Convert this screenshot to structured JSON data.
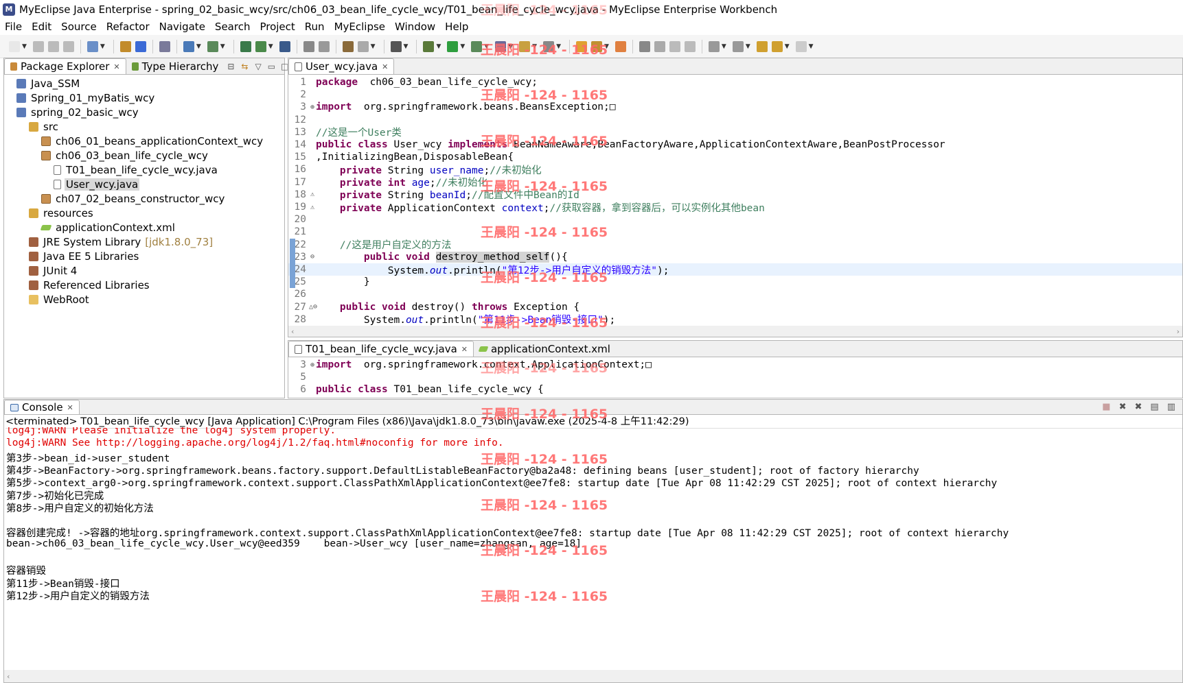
{
  "window": {
    "title": "MyEclipse Java Enterprise - spring_02_basic_wcy/src/ch06_03_bean_life_cycle_wcy/T01_bean_life_cycle_wcy.java - MyEclipse Enterprise Workbench"
  },
  "menu": [
    "File",
    "Edit",
    "Source",
    "Refactor",
    "Navigate",
    "Search",
    "Project",
    "Run",
    "MyEclipse",
    "Window",
    "Help"
  ],
  "explorer": {
    "tab_package": "Package Explorer",
    "tab_hierarchy": "Type Hierarchy",
    "items": [
      {
        "label": "Java_SSM",
        "icon": "project-icon"
      },
      {
        "label": "Spring_01_myBatis_wcy",
        "icon": "project-icon"
      },
      {
        "label": "spring_02_basic_wcy",
        "icon": "project-icon"
      },
      {
        "label": "src",
        "icon": "source-folder-icon"
      },
      {
        "label": "ch06_01_beans_applicationContext_wcy",
        "icon": "package-icon"
      },
      {
        "label": "ch06_03_bean_life_cycle_wcy",
        "icon": "package-icon"
      },
      {
        "label": "T01_bean_life_cycle_wcy.java",
        "icon": "java-file-icon"
      },
      {
        "label": "User_wcy.java",
        "icon": "java-file-icon"
      },
      {
        "label": "ch07_02_beans_constructor_wcy",
        "icon": "package-icon"
      },
      {
        "label": "resources",
        "icon": "source-folder-icon"
      },
      {
        "label": "applicationContext.xml",
        "icon": "xml-file-icon"
      },
      {
        "label": "JRE System Library",
        "extra": "[jdk1.8.0_73]",
        "icon": "library-icon"
      },
      {
        "label": "Java EE 5 Libraries",
        "icon": "library-icon"
      },
      {
        "label": "JUnit 4",
        "icon": "library-icon"
      },
      {
        "label": "Referenced Libraries",
        "icon": "library-icon"
      },
      {
        "label": "WebRoot",
        "icon": "folder-icon"
      }
    ]
  },
  "editor1": {
    "tab": "User_wcy.java",
    "lines": [
      {
        "n": "1",
        "t": [
          [
            "kw",
            "package"
          ],
          [
            "",
            "  ch06_03_bean_life_cycle_wcy;"
          ]
        ]
      },
      {
        "n": "2",
        "t": []
      },
      {
        "n": "3",
        "g": "⊕",
        "t": [
          [
            "kw",
            "import"
          ],
          [
            "",
            "  org.springframework.beans.BeansException;□"
          ]
        ]
      },
      {
        "n": "12",
        "t": []
      },
      {
        "n": "13",
        "t": [
          [
            "cm",
            "//这是一个User类"
          ]
        ]
      },
      {
        "n": "14",
        "t": [
          [
            "kw",
            "public class"
          ],
          [
            "",
            " User_wcy "
          ],
          [
            "kw",
            "implements"
          ],
          [
            "",
            " BeanNameAware,BeanFactoryAware,ApplicationContextAware,BeanPostProcessor"
          ]
        ]
      },
      {
        "n": "15",
        "t": [
          [
            "",
            ",InitializingBean,DisposableBean{"
          ]
        ]
      },
      {
        "n": "16",
        "t": [
          [
            "",
            "    "
          ],
          [
            "kw",
            "private"
          ],
          [
            "",
            " String "
          ],
          [
            "fld",
            "user_name"
          ],
          [
            "",
            ";"
          ],
          [
            "cm",
            "//未初始化"
          ]
        ]
      },
      {
        "n": "17",
        "t": [
          [
            "",
            "    "
          ],
          [
            "kw",
            "private int"
          ],
          [
            "",
            " "
          ],
          [
            "fld",
            "age"
          ],
          [
            "",
            ";"
          ],
          [
            "cm",
            "//未初始化"
          ]
        ]
      },
      {
        "n": "18",
        "g": "⚠",
        "t": [
          [
            "",
            "    "
          ],
          [
            "kw",
            "private"
          ],
          [
            "",
            " String "
          ],
          [
            "fld",
            "beanId"
          ],
          [
            "",
            ";"
          ],
          [
            "cm",
            "//配置文件中Bean的Id"
          ]
        ]
      },
      {
        "n": "19",
        "g": "⚠",
        "t": [
          [
            "",
            "    "
          ],
          [
            "kw",
            "private"
          ],
          [
            "",
            " ApplicationContext "
          ],
          [
            "fld",
            "context"
          ],
          [
            "",
            ";"
          ],
          [
            "cm",
            "//获取容器，拿到容器后，可以实例化其他bean"
          ]
        ]
      },
      {
        "n": "20",
        "t": []
      },
      {
        "n": "21",
        "t": []
      },
      {
        "n": "22",
        "t": [
          [
            "",
            "    "
          ],
          [
            "cm",
            "//这是用户自定义的方法"
          ]
        ]
      },
      {
        "n": "23",
        "g": "⊖",
        "t": [
          [
            "",
            "        "
          ],
          [
            "kw",
            "public void"
          ],
          [
            "",
            " "
          ],
          [
            "occ",
            "destroy_method_self"
          ],
          [
            "",
            "(){"
          ]
        ]
      },
      {
        "n": "24",
        "hl": true,
        "t": [
          [
            "",
            "            System."
          ],
          [
            "ital",
            "out"
          ],
          [
            "",
            ".println("
          ],
          [
            "str",
            "\"第12步->用户自定义的销毁方法\""
          ],
          [
            "",
            ");"
          ]
        ]
      },
      {
        "n": "25",
        "t": [
          [
            "",
            "        }"
          ]
        ]
      },
      {
        "n": "26",
        "t": []
      },
      {
        "n": "27",
        "g": "△⊖",
        "t": [
          [
            "",
            "    "
          ],
          [
            "kw",
            "public void"
          ],
          [
            "",
            " destroy() "
          ],
          [
            "kw",
            "throws"
          ],
          [
            "",
            " Exception {"
          ]
        ]
      },
      {
        "n": "28",
        "t": [
          [
            "",
            "        System."
          ],
          [
            "ital",
            "out"
          ],
          [
            "",
            ".println("
          ],
          [
            "str",
            "\"第11步->Bean销毁-接口\""
          ],
          [
            "",
            ");"
          ]
        ]
      }
    ]
  },
  "editor2": {
    "tab1": "T01_bean_life_cycle_wcy.java",
    "tab2": "applicationContext.xml",
    "lines": [
      {
        "n": "3",
        "g": "⊕",
        "t": [
          [
            "kw",
            "import"
          ],
          [
            "",
            "  org.springframework.context.ApplicationContext;□"
          ]
        ]
      },
      {
        "n": "5",
        "t": []
      },
      {
        "n": "6",
        "t": [
          [
            "kw",
            "public class"
          ],
          [
            "",
            " T01_bean_life_cycle_wcy {"
          ]
        ]
      }
    ]
  },
  "console": {
    "tab": "Console",
    "header": "<terminated> T01_bean_life_cycle_wcy [Java Application] C:\\Program Files (x86)\\Java\\jdk1.8.0_73\\bin\\javaw.exe (2025-4-8 上午11:42:29)",
    "lines": [
      {
        "c": "red",
        "t": "log4j:WARN Please initialize the log4j system properly."
      },
      {
        "c": "red",
        "t": "log4j:WARN See http://logging.apache.org/log4j/1.2/faq.html#noconfig for more info."
      },
      {
        "c": "",
        "t": "第3步->bean_id->user_student"
      },
      {
        "c": "",
        "t": "第4步->BeanFactory->org.springframework.beans.factory.support.DefaultListableBeanFactory@ba2a48: defining beans [user_student]; root of factory hierarchy"
      },
      {
        "c": "",
        "t": "第5步->context_arg0->org.springframework.context.support.ClassPathXmlApplicationContext@ee7fe8: startup date [Tue Apr 08 11:42:29 CST 2025]; root of context hierarchy"
      },
      {
        "c": "",
        "t": "第7步->初始化已完成"
      },
      {
        "c": "",
        "t": "第8步->用户自定义的初始化方法"
      },
      {
        "c": "",
        "t": ""
      },
      {
        "c": "",
        "t": "容器创建完成! ->容器的地址org.springframework.context.support.ClassPathXmlApplicationContext@ee7fe8: startup date [Tue Apr 08 11:42:29 CST 2025]; root of context hierarchy"
      },
      {
        "c": "",
        "t": "bean->ch06_03_bean_life_cycle_wcy.User_wcy@eed359    bean->User_wcy [user_name=zhangsan, age=18]"
      },
      {
        "c": "",
        "t": ""
      },
      {
        "c": "",
        "t": "容器销毁"
      },
      {
        "c": "",
        "t": "第11步->Bean销毁-接口"
      },
      {
        "c": "",
        "t": "第12步->用户自定义的销毁方法"
      }
    ]
  },
  "watermark": "王晨阳 -124 - 1165"
}
